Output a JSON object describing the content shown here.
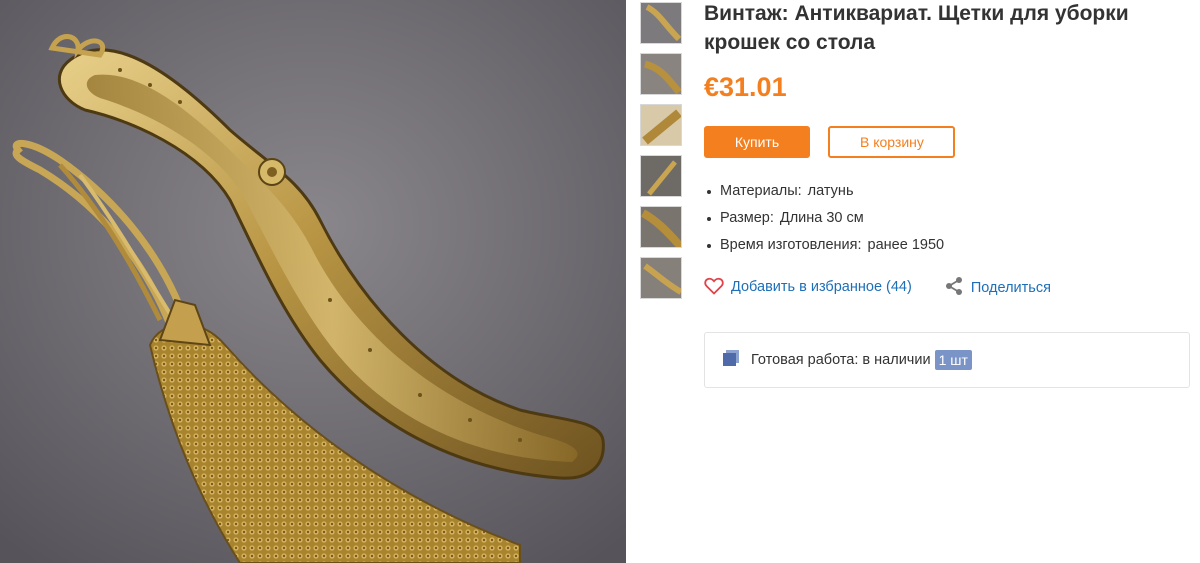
{
  "product": {
    "title": "Винтаж: Антиквариат. Щетки для уборки крошек со стола",
    "price": "€31.01",
    "images": {
      "main_alt_icon": "brass-crumb-brush-photo",
      "thumbnail_count": 6
    }
  },
  "buttons": {
    "buy_label": "Купить",
    "cart_label": "В корзину"
  },
  "properties": [
    {
      "label": "Материалы:",
      "value": "латунь"
    },
    {
      "label": "Размер:",
      "value": "Длина 30 см"
    },
    {
      "label": "Время изготовления:",
      "value": "ранее 1950"
    }
  ],
  "actions": {
    "favorite_label": "Добавить в избранное (44)",
    "favorite_icon": "heart-icon",
    "share_label": "Поделиться",
    "share_icon": "share-icon"
  },
  "stock": {
    "icon": "box-icon",
    "label": "Готовая работа: в наличии",
    "quantity": "1 шт"
  },
  "colors": {
    "accent": "#f47f1f",
    "link": "#1d6fb8",
    "badge": "#7b94c8",
    "heart": "#e0444c"
  }
}
